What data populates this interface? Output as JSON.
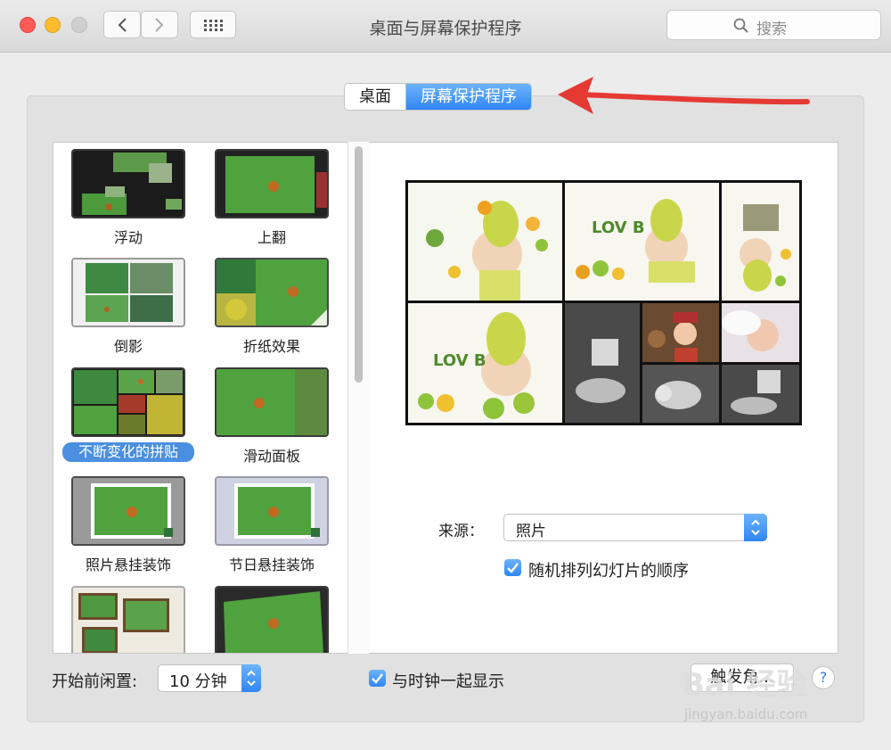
{
  "window": {
    "title": "桌面与屏幕保护程序"
  },
  "toolbar": {
    "search_placeholder": "搜索"
  },
  "tabs": [
    {
      "label": "桌面",
      "selected": false
    },
    {
      "label": "屏幕保护程序",
      "selected": true
    }
  ],
  "screensavers": [
    {
      "label": "浮动",
      "selected": false
    },
    {
      "label": "上翻",
      "selected": false
    },
    {
      "label": "倒影",
      "selected": false
    },
    {
      "label": "折纸效果",
      "selected": false
    },
    {
      "label": "不断变化的拼贴",
      "selected": true
    },
    {
      "label": "滑动面板",
      "selected": false
    },
    {
      "label": "照片悬挂装饰",
      "selected": false
    },
    {
      "label": "节日悬挂装饰",
      "selected": false
    }
  ],
  "options": {
    "source_label": "来源：",
    "source_value": "照片",
    "shuffle_label": "随机排列幻灯片的顺序",
    "shuffle_checked": true
  },
  "footer": {
    "idle_label": "开始前闲置:",
    "idle_value": "10 分钟",
    "show_clock_label": "与时钟一起显示",
    "show_clock_checked": true,
    "hot_corners_label": "触发角...",
    "help_label": "?"
  },
  "watermark": {
    "brand": "Bai 经验",
    "url": "jingyan.baidu.com"
  },
  "colors": {
    "accent": "#2f86f4",
    "annotation_arrow": "#e53a33"
  }
}
